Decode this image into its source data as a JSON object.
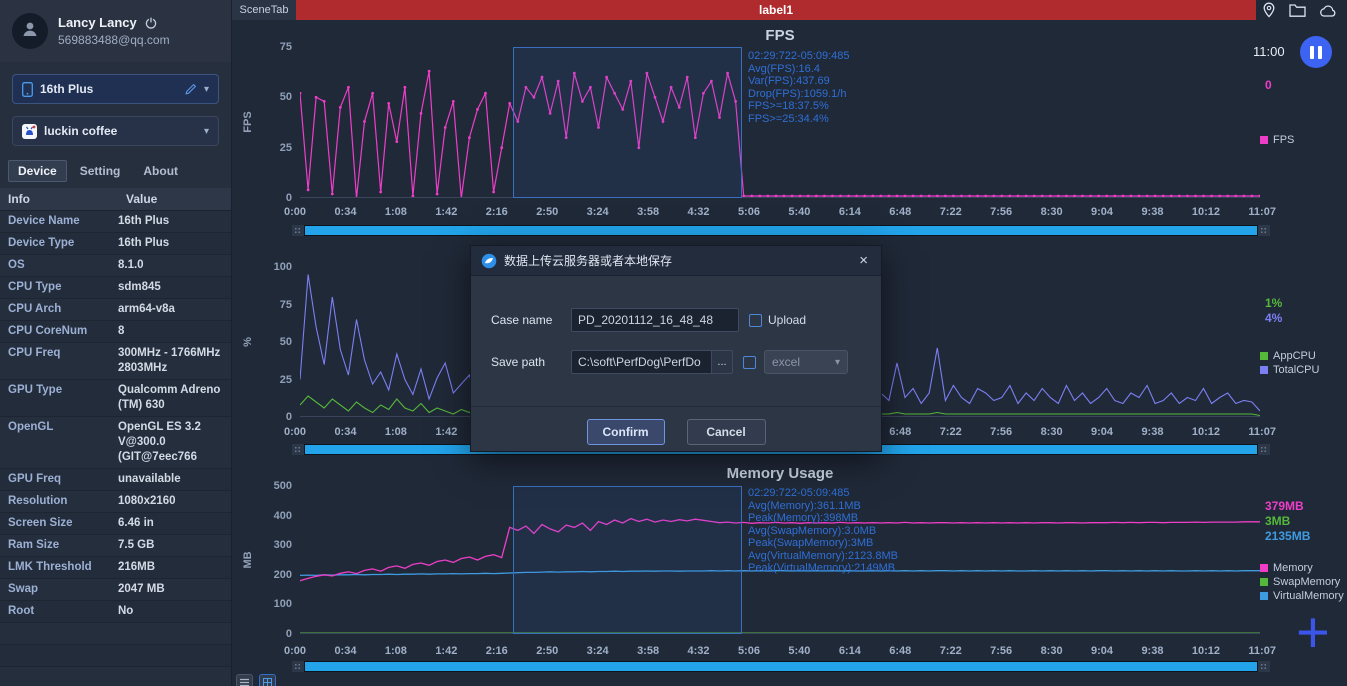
{
  "topbar": {
    "scene_tab": "SceneTab",
    "label": "label1"
  },
  "icons": {
    "caret": "▾",
    "close": "×",
    "browse": "...",
    "plus": "+"
  },
  "colors": {
    "accent_red": "#b02b2e",
    "pink": "#ee3ec8",
    "green": "#55b83a",
    "purple": "#7b7ff2",
    "blue": "#3f9be0",
    "stats_blue": "#2f6fd6",
    "scroll_thumb": "#22a3ea",
    "pause_button": "#3c63f2"
  },
  "sidebar": {
    "user": {
      "name": "Lancy Lancy",
      "email": "569883488@qq.com"
    },
    "device_select": {
      "label": "16th Plus"
    },
    "app_select": {
      "label": "luckin coffee"
    },
    "tabs": [
      {
        "label": "Device"
      },
      {
        "label": "Setting"
      },
      {
        "label": "About"
      }
    ],
    "info_table": {
      "headers": [
        "Info",
        "Value"
      ],
      "rows": [
        [
          "Device Name",
          "16th Plus"
        ],
        [
          "Device Type",
          "16th Plus"
        ],
        [
          "OS",
          "8.1.0"
        ],
        [
          "CPU Type",
          "sdm845"
        ],
        [
          "CPU Arch",
          "arm64-v8a"
        ],
        [
          "CPU CoreNum",
          "8"
        ],
        [
          "CPU Freq",
          "300MHz - 1766MHz\n2803MHz"
        ],
        [
          "GPU Type",
          "Qualcomm Adreno\n(TM) 630"
        ],
        [
          "OpenGL",
          "OpenGL ES 3.2\nV@300.0\n(GIT@7eec766"
        ],
        [
          "GPU Freq",
          "unavailable"
        ],
        [
          "Resolution",
          "1080x2160"
        ],
        [
          "Screen Size",
          "6.46 in"
        ],
        [
          "Ram Size",
          "7.5 GB"
        ],
        [
          "LMK Threshold",
          "216MB"
        ],
        [
          "Swap",
          "2047 MB"
        ],
        [
          "Root",
          "No"
        ],
        [
          "",
          ""
        ],
        [
          "",
          ""
        ],
        [
          "",
          ""
        ]
      ]
    }
  },
  "right_panel": {
    "fps": {
      "time": "11:00",
      "values": [
        {
          "text": "0",
          "color": "#ee3ec8"
        }
      ],
      "legend": [
        {
          "label": "FPS",
          "color": "#ee3ec8"
        }
      ]
    },
    "cpu": {
      "values": [
        {
          "text": "1%",
          "color": "#55b83a"
        },
        {
          "text": "4%",
          "color": "#7b7ff2"
        }
      ],
      "legend": [
        {
          "label": "AppCPU",
          "color": "#55b83a"
        },
        {
          "label": "TotalCPU",
          "color": "#7b7ff2"
        }
      ]
    },
    "memory": {
      "values": [
        {
          "text": "379MB",
          "color": "#ee3ec8"
        },
        {
          "text": "3MB",
          "color": "#55b83a"
        },
        {
          "text": "2135MB",
          "color": "#3f9be0"
        }
      ],
      "legend": [
        {
          "label": "Memory",
          "color": "#ee3ec8"
        },
        {
          "label": "SwapMemory",
          "color": "#55b83a"
        },
        {
          "label": "VirtualMemory",
          "color": "#3f9be0"
        }
      ]
    },
    "plus": "+"
  },
  "dialog": {
    "title": "数据上传云服务器或者本地保存",
    "case_name_label": "Case name",
    "case_name_value": "PD_20201112_16_48_48",
    "upload_label": "Upload",
    "save_path_label": "Save path",
    "save_path_value": "C:\\soft\\PerfDog\\PerfDo",
    "format_value": "excel",
    "confirm_label": "Confirm",
    "cancel_label": "Cancel"
  },
  "chart_data": [
    {
      "type": "line",
      "title": "FPS",
      "ylabel": "FPS",
      "ylim": [
        0,
        75
      ],
      "yticks": [
        0,
        25,
        50,
        75
      ],
      "legend_position": "right",
      "grid": false,
      "selection": {
        "from": 0.222,
        "to": 0.46
      },
      "stats": [
        "02:29:722-05:09:485",
        "Avg(FPS):16.4",
        "Var(FPS):437.69",
        "Drop(FPS):1059.1/h",
        "FPS>=18:37.5%",
        "FPS>=25:34.4%"
      ],
      "xticks": [
        "0:00",
        "0:34",
        "1:08",
        "1:42",
        "2:16",
        "2:50",
        "3:24",
        "3:58",
        "4:32",
        "5:06",
        "5:40",
        "6:14",
        "6:48",
        "7:22",
        "7:56",
        "8:30",
        "9:04",
        "9:38",
        "10:12",
        "11:07"
      ],
      "series": [
        {
          "name": "FPS",
          "color": "#ee3ec8",
          "width": 1.2,
          "markers": true,
          "values": [
            52,
            4,
            50,
            48,
            2,
            45,
            55,
            0,
            38,
            52,
            3,
            47,
            28,
            55,
            1,
            42,
            63,
            2,
            35,
            48,
            0,
            30,
            44,
            52,
            3,
            25,
            47,
            38,
            55,
            50,
            60,
            42,
            58,
            30,
            62,
            48,
            55,
            35,
            60,
            52,
            44,
            58,
            25,
            62,
            50,
            38,
            55,
            45,
            60,
            30,
            52,
            58,
            40,
            62,
            48,
            1,
            1,
            1,
            1,
            1,
            1,
            1,
            1,
            1,
            1,
            1,
            1,
            1,
            1,
            1,
            1,
            1,
            1,
            1,
            1,
            1,
            1,
            1,
            1,
            1,
            1,
            1,
            1,
            1,
            1,
            1,
            1,
            1,
            1,
            1,
            1,
            1,
            1,
            1,
            1,
            1,
            1,
            1,
            1,
            1,
            1,
            1,
            1,
            1,
            1,
            1,
            1,
            1,
            1,
            1,
            1,
            1,
            1,
            1,
            1,
            1,
            1,
            1,
            1,
            1
          ]
        }
      ]
    },
    {
      "type": "line",
      "title": "",
      "ylabel": "%",
      "ylim": [
        0,
        100
      ],
      "yticks": [
        0,
        25,
        50,
        75,
        100
      ],
      "legend_position": "right",
      "grid": false,
      "xticks": [
        "0:00",
        "0:34",
        "1:08",
        "1:42",
        "2:16",
        "2:50",
        "3:24",
        "3:58",
        "4:32",
        "5:06",
        "5:40",
        "6:14",
        "6:48",
        "7:22",
        "7:56",
        "8:30",
        "9:04",
        "9:38",
        "10:12",
        "11:07"
      ],
      "series": [
        {
          "name": "AppCPU",
          "color": "#55b83a",
          "width": 1.1,
          "values": [
            8,
            14,
            10,
            6,
            12,
            8,
            4,
            10,
            6,
            3,
            8,
            5,
            12,
            6,
            4,
            9,
            3,
            6,
            4,
            2,
            5,
            3,
            6,
            2,
            4,
            3,
            2,
            5,
            2,
            3,
            4,
            2,
            3,
            2,
            4,
            2,
            3,
            2,
            2,
            3,
            2,
            4,
            2,
            2,
            3,
            2,
            2,
            3,
            2,
            2,
            2,
            3,
            2,
            2,
            2,
            2,
            3,
            2,
            2,
            2,
            2,
            2,
            3,
            2,
            2,
            2,
            2,
            2,
            2,
            2,
            2,
            2,
            2,
            2,
            3,
            2,
            2,
            2,
            2,
            3,
            2,
            2,
            2,
            2,
            2,
            2,
            2,
            2,
            2,
            2,
            2,
            2,
            2,
            2,
            2,
            2,
            2,
            2,
            2,
            2,
            2,
            2,
            2,
            2,
            2,
            2,
            2,
            2,
            2,
            2,
            2,
            2,
            2,
            2,
            2,
            2,
            2,
            2,
            2,
            1
          ]
        },
        {
          "name": "TotalCPU",
          "color": "#7b7ff2",
          "width": 1.1,
          "values": [
            25,
            95,
            60,
            35,
            80,
            45,
            28,
            65,
            38,
            22,
            30,
            18,
            42,
            25,
            15,
            32,
            12,
            26,
            36,
            16,
            22,
            28,
            10,
            24,
            32,
            14,
            18,
            26,
            9,
            22,
            16,
            28,
            11,
            19,
            23,
            12,
            26,
            16,
            9,
            21,
            13,
            19,
            11,
            23,
            15,
            9,
            19,
            13,
            21,
            11,
            16,
            23,
            9,
            19,
            13,
            26,
            11,
            16,
            21,
            9,
            13,
            19,
            11,
            23,
            9,
            16,
            13,
            21,
            11,
            19,
            9,
            13,
            16,
            11,
            36,
            13,
            19,
            9,
            16,
            46,
            11,
            21,
            13,
            9,
            19,
            16,
            11,
            13,
            21,
            9,
            16,
            11,
            19,
            13,
            9,
            21,
            11,
            16,
            9,
            13,
            19,
            11,
            9,
            16,
            13,
            21,
            9,
            11,
            16,
            9,
            13,
            11,
            19,
            9,
            13,
            16,
            9,
            11,
            10,
            4
          ]
        }
      ]
    },
    {
      "type": "line",
      "title": "Memory Usage",
      "ylabel": "MB",
      "ylim": [
        0,
        500
      ],
      "yticks": [
        0,
        100,
        200,
        300,
        400,
        500
      ],
      "legend_position": "right",
      "grid": false,
      "selection": {
        "from": 0.222,
        "to": 0.46
      },
      "stats": [
        "02:29:722-05:09:485",
        "Avg(Memory):361.1MB",
        "Peak(Memory):398MB",
        "Avg(SwapMemory):3.0MB",
        "Peak(SwapMemory):3MB",
        "Avg(VirtualMemory):2123.8MB",
        "Peak(VirtualMemory):2149MB"
      ],
      "xticks": [
        "0:00",
        "0:34",
        "1:08",
        "1:42",
        "2:16",
        "2:50",
        "3:24",
        "3:58",
        "4:32",
        "5:06",
        "5:40",
        "6:14",
        "6:48",
        "7:22",
        "7:56",
        "8:30",
        "9:04",
        "9:38",
        "10:12",
        "11:07"
      ],
      "series": [
        {
          "name": "SwapMemory",
          "color": "#55b83a",
          "width": 1.2,
          "values": [
            3,
            3
          ]
        },
        {
          "name": "VirtualMemory",
          "color": "#3f9be0",
          "width": 1.3,
          "values": [
            198,
            199,
            198,
            200,
            199,
            200,
            200,
            201,
            200,
            201,
            201,
            202,
            201,
            202,
            202,
            203,
            202,
            203,
            203,
            204,
            203,
            204,
            204,
            205,
            204,
            205,
            206,
            207,
            208,
            208,
            209,
            210,
            209,
            210,
            210,
            211,
            210,
            211,
            211,
            212,
            211,
            212,
            212,
            213,
            212,
            213,
            213,
            212,
            213,
            213,
            213,
            214,
            213,
            214,
            213,
            214,
            213,
            214,
            213,
            214,
            214,
            213,
            214,
            213,
            214,
            213,
            214,
            213,
            214,
            213,
            213,
            214,
            213,
            214,
            213,
            214,
            213,
            214,
            213,
            214,
            214,
            213,
            214,
            213,
            214,
            213,
            214,
            213,
            214,
            213,
            213,
            214,
            213,
            214,
            213,
            214,
            213,
            214,
            213,
            214,
            214,
            213,
            214,
            213,
            214,
            213,
            214,
            213,
            214,
            213,
            213,
            214,
            213,
            214,
            213,
            214,
            213,
            214,
            214,
            214
          ]
        },
        {
          "name": "Memory",
          "color": "#ee3ec8",
          "width": 1.3,
          "values": [
            180,
            188,
            195,
            200,
            196,
            205,
            210,
            204,
            215,
            220,
            212,
            225,
            230,
            222,
            235,
            240,
            232,
            245,
            250,
            242,
            255,
            260,
            250,
            262,
            268,
            258,
            360,
            350,
            365,
            340,
            370,
            355,
            345,
            368,
            360,
            375,
            350,
            380,
            370,
            385,
            375,
            390,
            380,
            388,
            378,
            385,
            380,
            386,
            382,
            388,
            384,
            380,
            376,
            378,
            375,
            377,
            374,
            376,
            375,
            377,
            375,
            376,
            374,
            376,
            375,
            376,
            375,
            377,
            375,
            376,
            375,
            376,
            375,
            376,
            375,
            377,
            375,
            376,
            375,
            376,
            376,
            375,
            376,
            375,
            376,
            375,
            376,
            375,
            376,
            375,
            376,
            375,
            376,
            376,
            375,
            376,
            376,
            375,
            376,
            376,
            376,
            377,
            376,
            377,
            376,
            377,
            377,
            376,
            377,
            377,
            377,
            378,
            377,
            378,
            378,
            378,
            378,
            379,
            379,
            379
          ]
        }
      ]
    }
  ]
}
